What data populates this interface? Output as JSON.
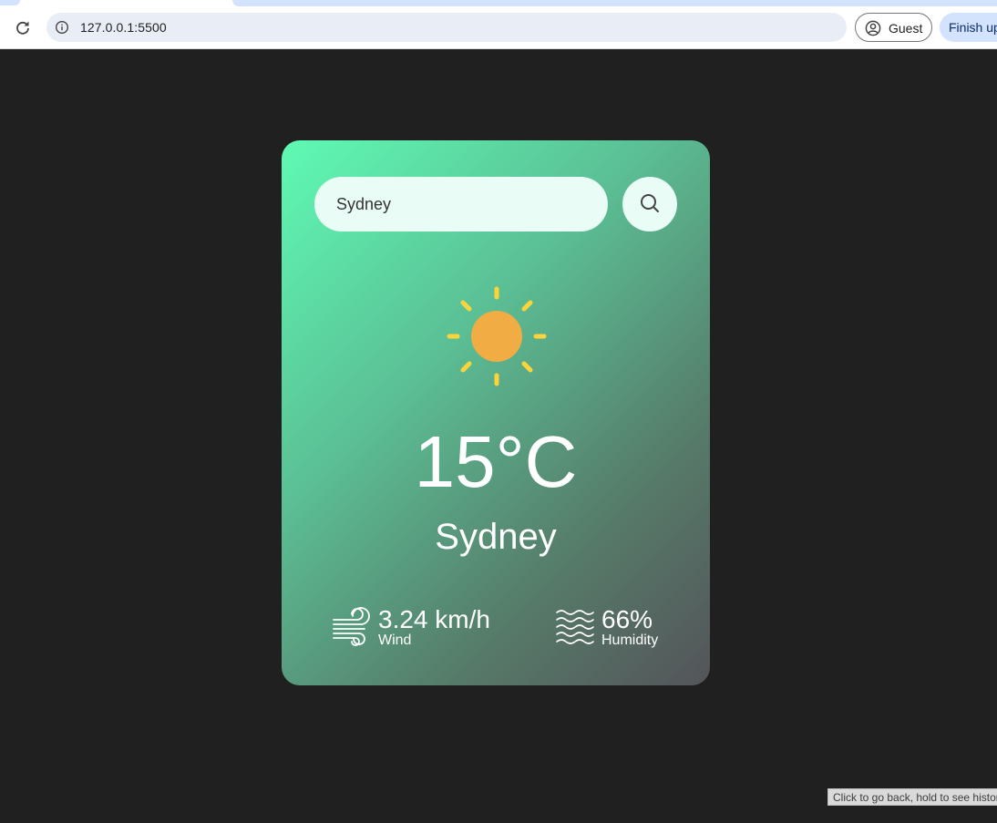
{
  "browser": {
    "url": "127.0.0.1:5500",
    "profile_label": "Guest",
    "finish_label": "Finish up",
    "tooltip": "Click to go back, hold to see history"
  },
  "weather": {
    "search_value": "Sydney",
    "temperature": "15°C",
    "city": "Sydney",
    "wind_value": "3.24 km/h",
    "wind_label": "Wind",
    "humidity_value": "66%",
    "humidity_label": "Humidity",
    "condition_icon": "sun-icon"
  },
  "colors": {
    "page_bg": "#202020",
    "card_gradient_start": "#5ffab4",
    "card_gradient_end": "#545459",
    "sun_core": "#f1ad43",
    "sun_rays": "#fcd43a"
  }
}
